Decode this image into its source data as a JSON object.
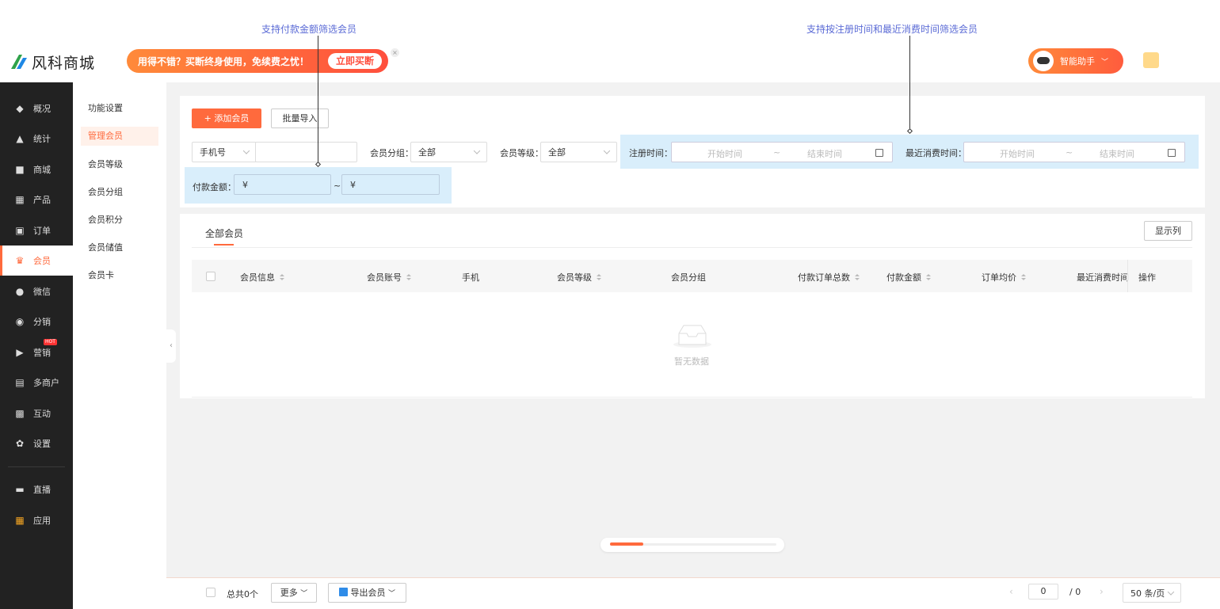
{
  "annotations": {
    "payment_filter": "支持付款金额筛选会员",
    "time_filter": "支持按注册时间和最近消费时间筛选会员"
  },
  "header": {
    "logo_text": "风科商城",
    "promo_text": "用得不错？买断终身使用，免续费之忧！",
    "promo_button": "立即买断",
    "assistant_label": "智能助手"
  },
  "sidebar": {
    "items": [
      {
        "label": "概况",
        "icon": "layers-icon"
      },
      {
        "label": "统计",
        "icon": "chart-icon"
      },
      {
        "label": "商城",
        "icon": "store-icon"
      },
      {
        "label": "产品",
        "icon": "grid-icon"
      },
      {
        "label": "订单",
        "icon": "clipboard-icon"
      },
      {
        "label": "会员",
        "icon": "crown-icon"
      },
      {
        "label": "微信",
        "icon": "wechat-icon"
      },
      {
        "label": "分销",
        "icon": "users-icon"
      },
      {
        "label": "营销",
        "icon": "flag-icon",
        "badge": "HOT"
      },
      {
        "label": "多商户",
        "icon": "merchant-icon"
      },
      {
        "label": "互动",
        "icon": "interact-icon"
      },
      {
        "label": "设置",
        "icon": "gear-icon"
      },
      {
        "label": "直播",
        "icon": "tv-icon"
      },
      {
        "label": "应用",
        "icon": "apps-icon"
      }
    ]
  },
  "submenu": {
    "items": [
      "功能设置",
      "管理会员",
      "会员等级",
      "会员分组",
      "会员积分",
      "会员储值",
      "会员卡"
    ]
  },
  "toolbar": {
    "add_member": "添加会员",
    "batch_import": "批量导入"
  },
  "filters": {
    "search_type": "手机号",
    "group_label": "会员分组：",
    "group_value": "全部",
    "level_label": "会员等级：",
    "level_value": "全部",
    "register_label": "注册时间：",
    "recent_label": "最近消费时间：",
    "start_placeholder": "开始时间",
    "end_placeholder": "结束时间",
    "range_sep": "~",
    "payment_label": "付款金额：",
    "currency": "¥"
  },
  "table": {
    "tab_all": "全部会员",
    "show_columns": "显示列",
    "columns": [
      "会员信息",
      "会员账号",
      "手机",
      "会员等级",
      "会员分组",
      "付款订单总数",
      "付款金额",
      "订单均价",
      "最近消费时间",
      "操作"
    ],
    "empty_text": "暂无数据"
  },
  "footer": {
    "total": "总共0个",
    "more": "更多",
    "export": "导出会员",
    "page_current": "0",
    "page_sep": "/ 0",
    "page_size": "50 条/页"
  }
}
